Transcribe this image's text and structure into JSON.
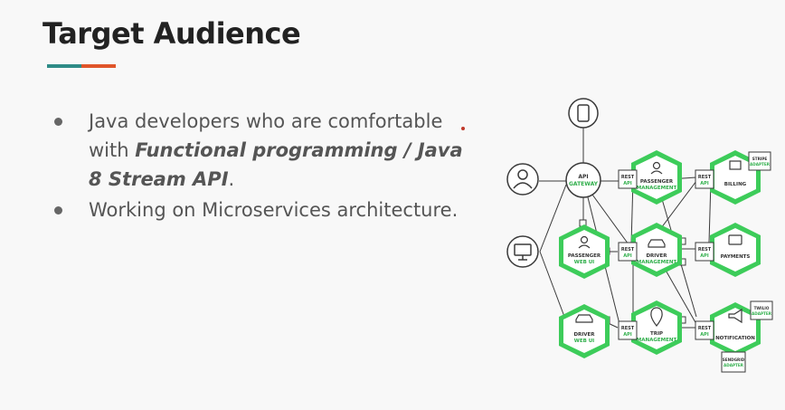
{
  "slide": {
    "title": "Target Audience",
    "accent_colors": [
      "#2e8b87",
      "#e0552a"
    ]
  },
  "bullets": [
    {
      "prefix": "Java developers who are comfortable with ",
      "emphasis": "Functional programming / Java 8 Stream API",
      "suffix": "."
    },
    {
      "prefix": "Working on Microservices architecture.",
      "emphasis": "",
      "suffix": ""
    }
  ],
  "diagram": {
    "colors": {
      "service": "#3dcc5a",
      "stroke": "#3a3a3a"
    },
    "gateway": {
      "line1": "API",
      "line2": "GATEWAY"
    },
    "rest_label": {
      "line1": "REST",
      "line2": "API"
    },
    "services": {
      "passenger_management": {
        "line1": "PASSENGER",
        "line2": "MANAGEMENT"
      },
      "billing": {
        "line1": "BILLING"
      },
      "passenger_web_ui": {
        "line1": "PASSENGER",
        "line2": "WEB UI"
      },
      "driver_management": {
        "line1": "DRIVER",
        "line2": "MANAGEMENT"
      },
      "payments": {
        "line1": "PAYMENTS"
      },
      "driver_web_ui": {
        "line1": "DRIVER",
        "line2": "WEB UI"
      },
      "trip_management": {
        "line1": "TRIP",
        "line2": "MANAGEMENT"
      },
      "notification": {
        "line1": "NOTIFICATION"
      }
    },
    "adapters": {
      "stripe": {
        "line1": "STRIPE",
        "line2": "ADAPTER"
      },
      "twilio": {
        "line1": "TWILIO",
        "line2": "ADAPTER"
      },
      "sendgrid": {
        "line1": "SENDGRID",
        "line2": "ADAPTER"
      }
    }
  }
}
